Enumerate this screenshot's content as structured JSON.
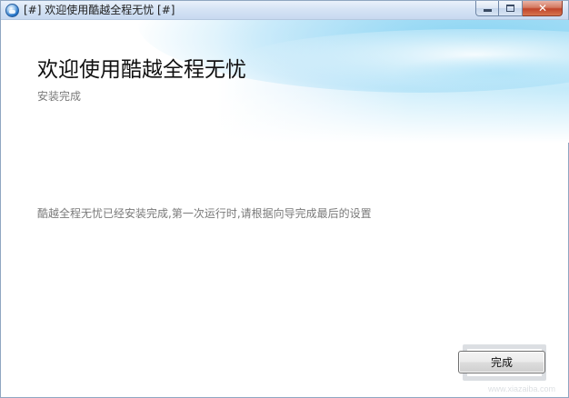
{
  "window": {
    "title": "[#] 欢迎使用酷越全程无忧 [#]",
    "icon": "app-globe-icon",
    "caption": {
      "minimize_icon": "minimize-icon",
      "maximize_icon": "maximize-icon",
      "close_icon": "close-icon",
      "close_glyph": "✕"
    }
  },
  "header": {
    "title": "欢迎使用酷越全程无忧",
    "subtitle": "安装完成"
  },
  "content": {
    "message": "酷越全程无忧已经安装完成,第一次运行时,请根据向导完成最后的设置"
  },
  "footer": {
    "finish_label": "完成"
  },
  "watermark": {
    "domain": "www.xiazaiba.com"
  },
  "colors": {
    "accent": "#6ec8ef",
    "title_text": "#111111",
    "secondary_text": "#7a7a7a",
    "close_button": "#c7452a"
  }
}
